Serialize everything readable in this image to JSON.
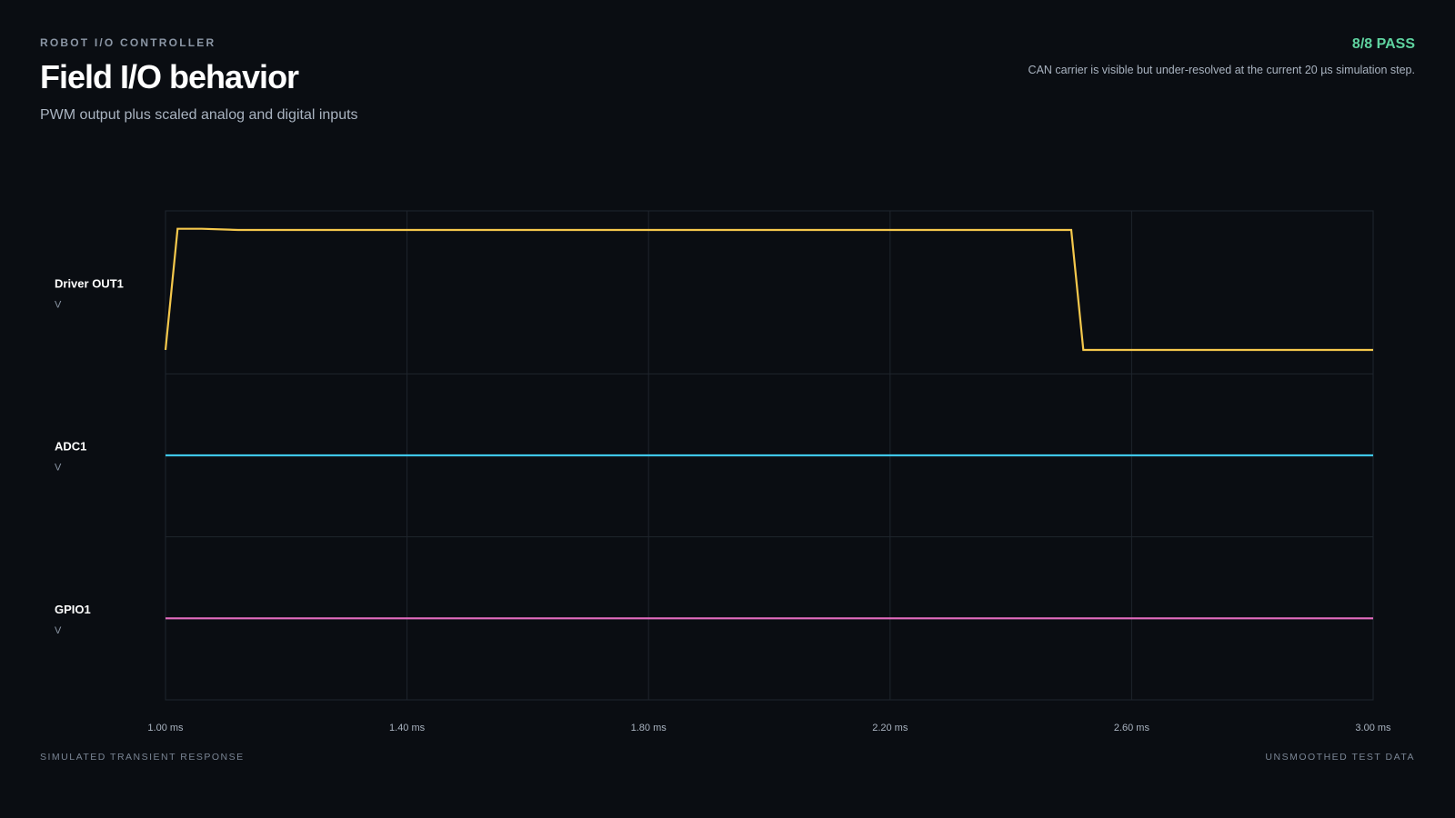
{
  "header": {
    "eyebrow": "ROBOT I/O CONTROLLER",
    "title": "Field I/O behavior",
    "subtitle": "PWM output plus scaled analog and digital inputs",
    "status": "8/8 PASS",
    "note": "CAN carrier is visible but under-resolved at the current 20 µs simulation step."
  },
  "footer": {
    "left": "SIMULATED TRANSIENT RESPONSE",
    "right": "UNSMOOTHED TEST DATA"
  },
  "colors": {
    "background": "#0a0d12",
    "grid": "#1f252d",
    "pass": "#5fd3a0",
    "driver_out1": "#f5c84c",
    "adc1": "#3fc6e8",
    "gpio1": "#e46cc0"
  },
  "chart_data": {
    "type": "line",
    "x_unit": "ms",
    "xlim": [
      1.0,
      3.0
    ],
    "x_ticks": [
      1.0,
      1.4,
      1.8,
      2.2,
      2.6,
      3.0
    ],
    "x_tick_labels": [
      "1.00 ms",
      "1.40 ms",
      "1.80 ms",
      "2.20 ms",
      "2.60 ms",
      "3.00 ms"
    ],
    "grid": true,
    "lanes": [
      {
        "name": "Driver OUT1",
        "unit": "V",
        "color": "#f5c84c",
        "ylim": [
          -0.1,
          1.05
        ],
        "x": [
          1.0,
          1.02,
          1.06,
          1.12,
          2.5,
          2.52,
          3.0
        ],
        "y": [
          0.0,
          1.0,
          1.0,
          0.99,
          0.99,
          0.0,
          0.0
        ]
      },
      {
        "name": "ADC1",
        "unit": "V",
        "color": "#3fc6e8",
        "ylim": [
          0,
          1
        ],
        "x": [
          1.0,
          3.0
        ],
        "y": [
          0.5,
          0.5
        ]
      },
      {
        "name": "GPIO1",
        "unit": "V",
        "color": "#e46cc0",
        "ylim": [
          0,
          1
        ],
        "x": [
          1.0,
          3.0
        ],
        "y": [
          0.5,
          0.5
        ]
      }
    ]
  }
}
